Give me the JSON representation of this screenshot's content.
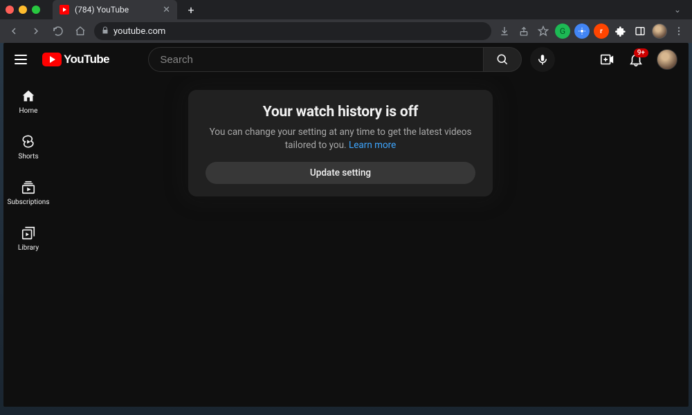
{
  "browser": {
    "tab_title": "(784) YouTube",
    "url": "youtube.com"
  },
  "yt_logo": "YouTube",
  "search": {
    "placeholder": "Search"
  },
  "notifications_badge": "9+",
  "rail": [
    {
      "label": "Home"
    },
    {
      "label": "Shorts"
    },
    {
      "label": "Subscriptions"
    },
    {
      "label": "Library"
    }
  ],
  "notice": {
    "title": "Your watch history is off",
    "desc_prefix": "You can change your setting at any time to get the latest videos tailored to you. ",
    "learn_more": "Learn more",
    "button": "Update setting"
  }
}
